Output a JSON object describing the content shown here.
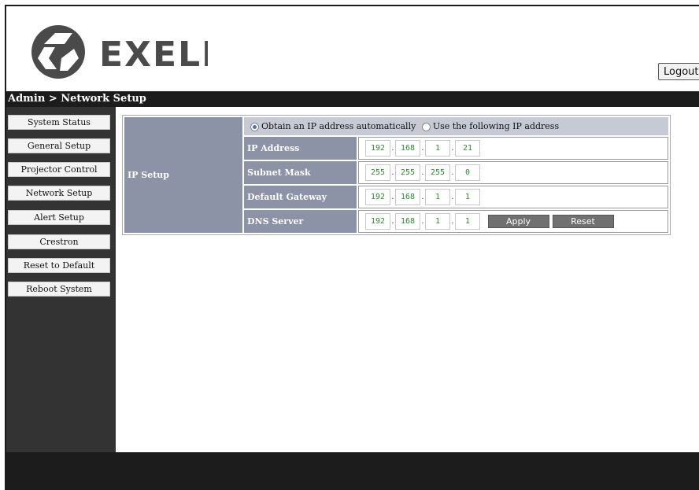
{
  "header": {
    "logo_text": "EXELL",
    "logout_label": "Logout"
  },
  "breadcrumb": "Admin > Network Setup",
  "sidebar": {
    "items": [
      {
        "label": "System Status"
      },
      {
        "label": "General Setup"
      },
      {
        "label": "Projector Control"
      },
      {
        "label": "Network Setup"
      },
      {
        "label": "Alert Setup"
      },
      {
        "label": "Crestron"
      },
      {
        "label": "Reset to Default"
      },
      {
        "label": "Reboot System"
      }
    ]
  },
  "ip_setup": {
    "section_label": "IP Setup",
    "option_auto": "Obtain an IP address automatically",
    "option_manual": "Use the following IP address",
    "selected": "auto",
    "fields": [
      {
        "label": "IP Address",
        "octets": [
          "192",
          "168",
          "1",
          "21"
        ]
      },
      {
        "label": "Subnet Mask",
        "octets": [
          "255",
          "255",
          "255",
          "0"
        ]
      },
      {
        "label": "Default Gateway",
        "octets": [
          "192",
          "168",
          "1",
          "1"
        ]
      },
      {
        "label": "DNS Server",
        "octets": [
          "192",
          "168",
          "1",
          "1"
        ]
      }
    ],
    "apply_label": "Apply",
    "reset_label": "Reset"
  },
  "colors": {
    "header_bar": "#1c1c1c",
    "sidebar_bg": "#333333",
    "label_cell": "#8d93a6",
    "ip_text": "#2f8a2f"
  }
}
